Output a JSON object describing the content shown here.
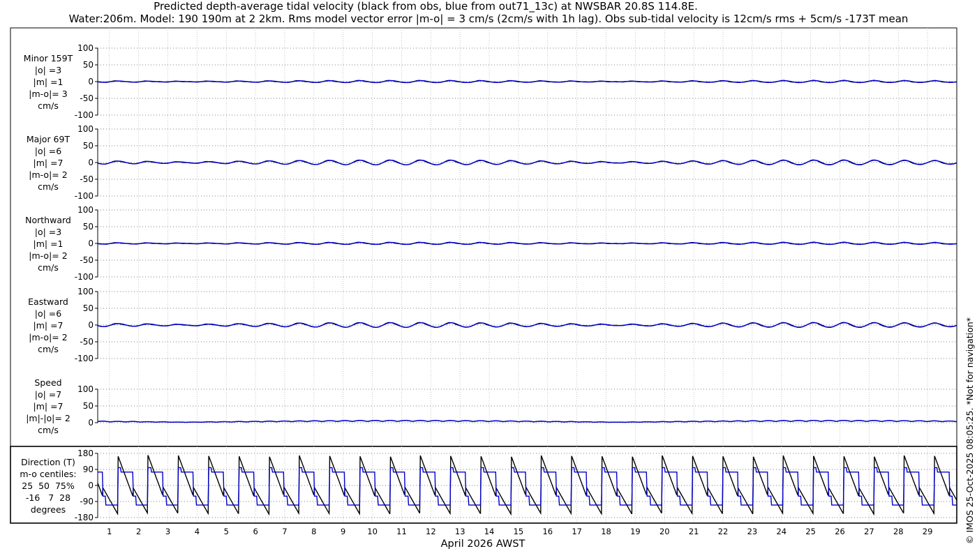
{
  "title_line1": "Predicted depth-average tidal velocity (black from obs, blue from out71_13c) at NWSBAR 20.8S 114.8E.",
  "title_line2": "Water:206m. Model: 190 190m at 2 2km. Rms model vector error |m-o| = 3 cm/s (2cm/s with 1h lag). Obs sub-tidal velocity is 12cm/s rms + 5cm/s -173T mean",
  "side_note": "© IMOS 25-Oct-2025 08:05:25. *Not for navigation*",
  "colors": {
    "obs": "#000000",
    "model": "#0000cc"
  },
  "chart_data": {
    "type": "line",
    "xlabel": "April 2026 AWST",
    "x_ticks": [
      "1",
      "2",
      "3",
      "4",
      "5",
      "6",
      "7",
      "8",
      "9",
      "10",
      "11",
      "12",
      "13",
      "14",
      "15",
      "16",
      "17",
      "18",
      "19",
      "20",
      "21",
      "22",
      "23",
      "24",
      "25",
      "26",
      "27",
      "28",
      "29"
    ],
    "x_range_days": [
      0.6,
      30.0
    ],
    "grid": true,
    "series": [
      {
        "name": "obs",
        "color": "#000000"
      },
      {
        "name": "model",
        "color": "#0000cc"
      }
    ],
    "panels": [
      {
        "label_lines": [
          "Minor 159T",
          "|o| =3",
          "|m| =1",
          "|m-o|= 3",
          "cm/s"
        ],
        "ylim": [
          -100,
          100
        ],
        "yticks": [
          100,
          50,
          0,
          -50,
          -100
        ],
        "amplitude": 3
      },
      {
        "label_lines": [
          "Major 69T",
          "|o| =6",
          "|m| =7",
          "|m-o|= 2",
          "cm/s"
        ],
        "ylim": [
          -100,
          100
        ],
        "yticks": [
          100,
          50,
          0,
          -50,
          -100
        ],
        "amplitude": 7
      },
      {
        "label_lines": [
          "Northward",
          "|o| =3",
          "|m| =1",
          "|m-o|= 2",
          "cm/s"
        ],
        "ylim": [
          -100,
          100
        ],
        "yticks": [
          100,
          50,
          0,
          -50,
          -100
        ],
        "amplitude": 3
      },
      {
        "label_lines": [
          "Eastward",
          "|o| =6",
          "|m| =7",
          "|m-o|= 2",
          "cm/s"
        ],
        "ylim": [
          -100,
          100
        ],
        "yticks": [
          100,
          50,
          0,
          -50,
          -100
        ],
        "amplitude": 7
      },
      {
        "label_lines": [
          "Speed",
          "|o| =7",
          "|m| =7",
          "|m|-|o|= 2",
          "cm/s"
        ],
        "ylim": [
          0,
          100
        ],
        "yticks": [
          100,
          50,
          0
        ],
        "amplitude": 7
      }
    ],
    "direction_panel": {
      "label_lines": [
        "Direction (T)",
        "m-o centiles:",
        "25  50  75%",
        "-16   7  28",
        "degrees"
      ],
      "ylim": [
        -180,
        180
      ],
      "yticks": [
        180,
        90,
        0,
        -90,
        -180
      ]
    }
  }
}
